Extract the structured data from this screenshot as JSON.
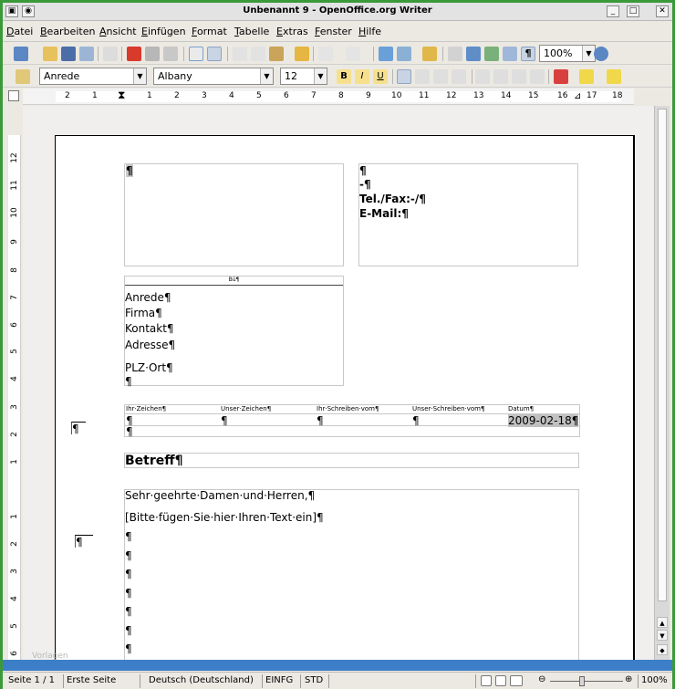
{
  "window": {
    "title": "Unbenannt 9 - OpenOffice.org Writer"
  },
  "menu": [
    "Datei",
    "Bearbeiten",
    "Ansicht",
    "Einfügen",
    "Format",
    "Tabelle",
    "Extras",
    "Fenster",
    "Hilfe"
  ],
  "toolbar": {
    "zoom_value": "100%",
    "style_value": "Anrede",
    "font_value": "Albany",
    "size_value": "12"
  },
  "ruler_h": [
    "2",
    "1",
    "1",
    "2",
    "3",
    "4",
    "5",
    "6",
    "7",
    "8",
    "9",
    "10",
    "11",
    "12",
    "13",
    "14",
    "15",
    "16",
    "17",
    "18"
  ],
  "ruler_v": [
    "12",
    "11",
    "10",
    "9",
    "8",
    "7",
    "6",
    "5",
    "4",
    "3",
    "2",
    "1",
    "1",
    "2",
    "3",
    "4",
    "5",
    "6"
  ],
  "document": {
    "pilcrow": "¶",
    "sender_lines": [
      "¶",
      "-¶",
      "Tel./Fax:-/¶",
      "E-Mail:¶"
    ],
    "return_address": "Bü¶",
    "recipient_lines": [
      "Anrede¶",
      "Firma¶",
      "Kontakt¶",
      "Adresse¶",
      "PLZ·Ort¶",
      "¶"
    ],
    "ref_headers": [
      "Ihr·Zeichen¶",
      "Unser·Zeichen¶",
      "Ihr·Schreiben·vom¶",
      "Unser·Schreiben·vom¶",
      "Datum¶"
    ],
    "ref_values": [
      "¶",
      "¶",
      "¶",
      "¶",
      "2009-02-18¶"
    ],
    "ref_extra": "¶",
    "subject": "Betreff¶",
    "salutation": "Sehr·geehrte·Damen·und·Herren,¶",
    "body_placeholder": "[Bitte·fügen·Sie·hier·Ihren·Text·ein]¶",
    "empty_paragraphs": [
      "¶",
      "¶",
      "¶",
      "¶",
      "¶",
      "¶",
      "¶"
    ],
    "margin_mark_1": "¶",
    "margin_mark_2": "¶",
    "watermark": "Vorlagen"
  },
  "status": {
    "page": "Seite 1 / 1",
    "page_style": "Erste Seite",
    "language": "Deutsch (Deutschland)",
    "insert_mode": "EINFG",
    "selection_mode": "STD",
    "zoom": "100%"
  },
  "colors": {
    "window_border": "#3a9a3a",
    "selection": "#3d7ec8",
    "date_highlight": "#c0c0c0"
  }
}
